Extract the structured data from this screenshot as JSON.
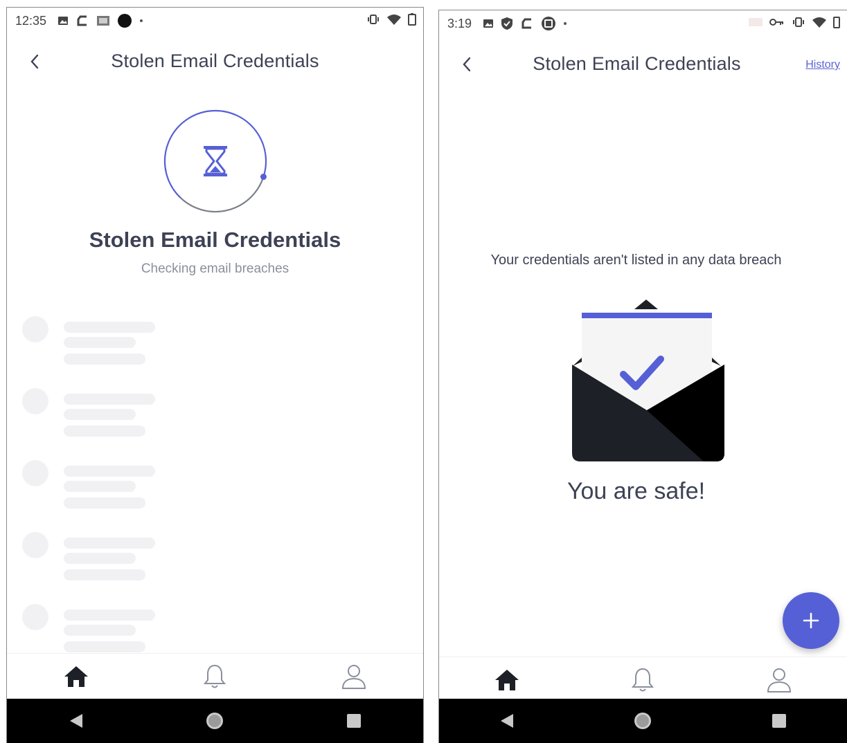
{
  "left": {
    "status": {
      "time": "12:35"
    },
    "appbar": {
      "title": "Stolen Email Credentials"
    },
    "scan": {
      "title": "Stolen Email Credentials",
      "subtitle": "Checking email breaches",
      "progress": 0.3
    },
    "skeleton_rows": 5,
    "nav": [
      "home-icon",
      "bell-icon",
      "user-icon"
    ]
  },
  "right": {
    "status": {
      "time": "3:19"
    },
    "appbar": {
      "title": "Stolen Email Credentials",
      "history": "History"
    },
    "message": "Your credentials aren't listed in any data breach",
    "result": "You are safe!",
    "fab_icon": "plus-icon",
    "nav": [
      "home-icon",
      "bell-icon",
      "user-icon"
    ]
  },
  "colors": {
    "accent": "#5560d6",
    "text_dark": "#3d4255",
    "text_muted": "#8a8f9c",
    "skeleton": "#f1f1f3",
    "envelope_dark": "#1d2026"
  }
}
